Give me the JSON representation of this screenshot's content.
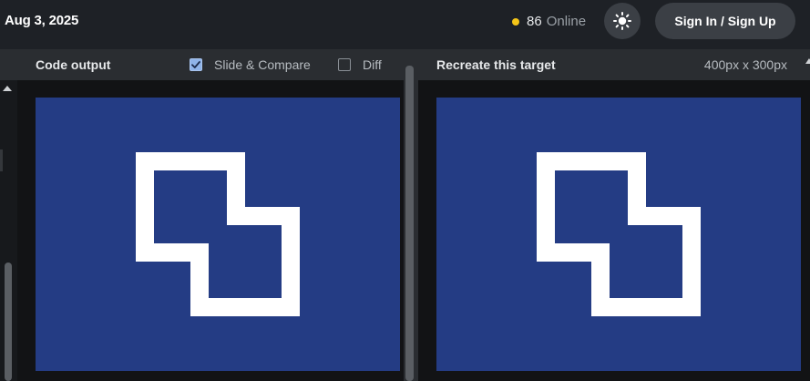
{
  "header": {
    "date": "Aug 3, 2025",
    "online_count": "86",
    "online_label": "Online",
    "theme_icon": "sun-icon",
    "signin_label": "Sign In / Sign Up"
  },
  "left_panel": {
    "title": "Code output",
    "slide_compare_label": "Slide & Compare",
    "slide_compare_checked": true,
    "diff_label": "Diff",
    "diff_checked": false
  },
  "right_panel": {
    "title": "Recreate this target",
    "dimensions": "400px x 300px"
  },
  "colors": {
    "canvas_bg": "#243c84",
    "shape": "#ffffff",
    "status_dot": "#f5c518",
    "checkbox_checked": "#8fb3e8"
  }
}
